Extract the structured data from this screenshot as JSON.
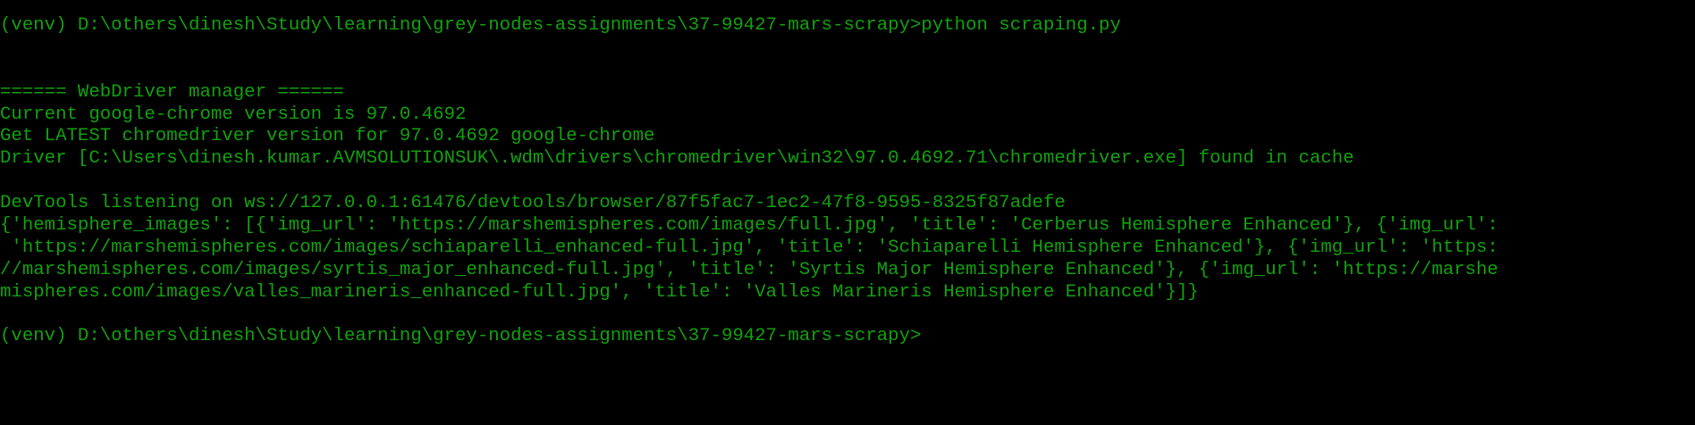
{
  "terminal": {
    "foreground_color": "#13a10e",
    "background_color": "#000000",
    "lines": [
      "(venv) D:\\others\\dinesh\\Study\\learning\\grey-nodes-assignments\\37-99427-mars-scrapy>python scraping.py",
      "",
      "",
      "====== WebDriver manager ======",
      "Current google-chrome version is 97.0.4692",
      "Get LATEST chromedriver version for 97.0.4692 google-chrome",
      "Driver [C:\\Users\\dinesh.kumar.AVMSOLUTIONSUK\\.wdm\\drivers\\chromedriver\\win32\\97.0.4692.71\\chromedriver.exe] found in cache",
      "",
      "DevTools listening on ws://127.0.0.1:61476/devtools/browser/87f5fac7-1ec2-47f8-9595-8325f87adefe",
      "{'hemisphere_images': [{'img_url': 'https://marshemispheres.com/images/full.jpg', 'title': 'Cerberus Hemisphere Enhanced'}, {'img_url':",
      " 'https://marshemispheres.com/images/schiaparelli_enhanced-full.jpg', 'title': 'Schiaparelli Hemisphere Enhanced'}, {'img_url': 'https:",
      "//marshemispheres.com/images/syrtis_major_enhanced-full.jpg', 'title': 'Syrtis Major Hemisphere Enhanced'}, {'img_url': 'https://marshe",
      "mispheres.com/images/valles_marineris_enhanced-full.jpg', 'title': 'Valles Marineris Hemisphere Enhanced'}]}",
      "",
      "(venv) D:\\others\\dinesh\\Study\\learning\\grey-nodes-assignments\\37-99427-mars-scrapy>"
    ]
  }
}
